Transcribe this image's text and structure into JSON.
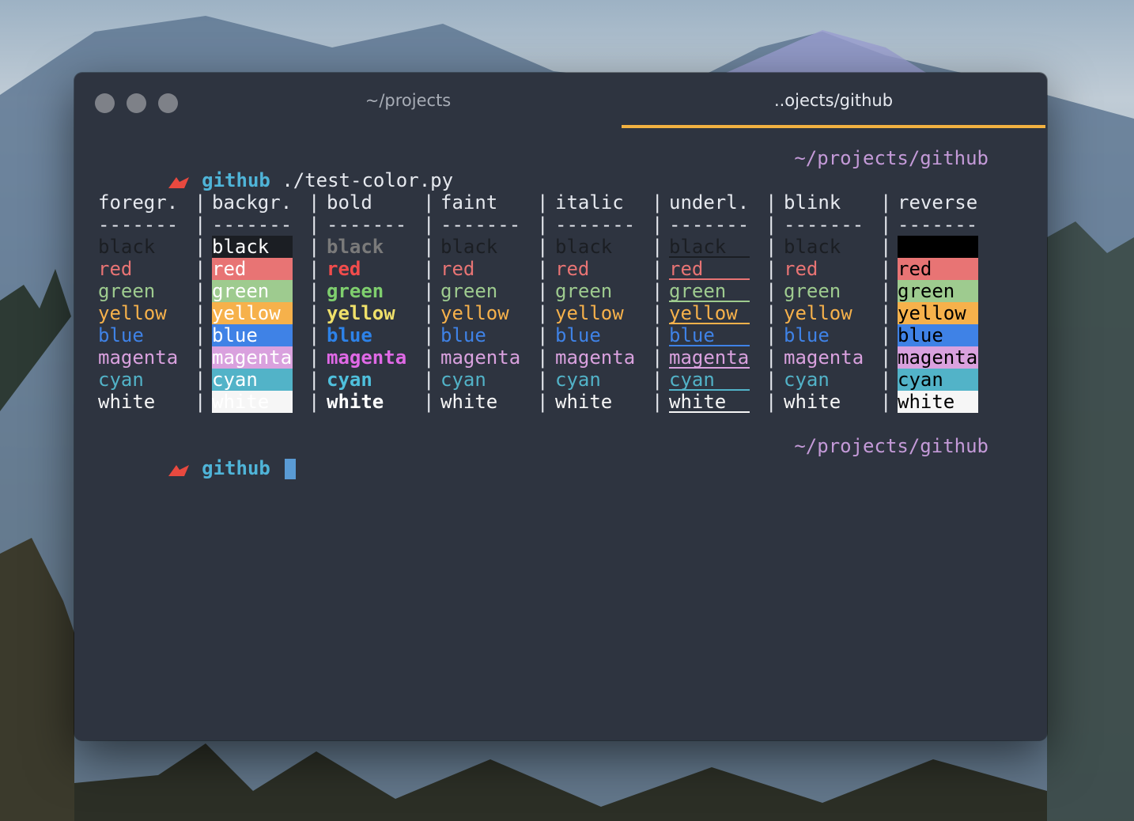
{
  "window": {
    "tabs": [
      {
        "label": "~/projects",
        "active": false
      },
      {
        "label": "..ojects/github",
        "active": true
      }
    ],
    "accent_color": "#f2b141"
  },
  "prompt1": {
    "dir": "github",
    "command": "./test-color.py",
    "path": "~/projects/github"
  },
  "prompt2": {
    "dir": "github",
    "path": "~/projects/github"
  },
  "table": {
    "headers": [
      "foregr.",
      "backgr.",
      "bold",
      "faint",
      "italic",
      "underl.",
      "blink",
      "reverse"
    ],
    "dashes": "-------",
    "separator": "|",
    "colors": [
      "black",
      "red",
      "green",
      "yellow",
      "blue",
      "magenta",
      "cyan",
      "white"
    ]
  },
  "palette": {
    "black": "#1b1e23",
    "red": "#e87474",
    "green": "#9ecb8f",
    "yellow": "#f6b14b",
    "blue": "#3f82e6",
    "magenta": "#d9a1de",
    "cyan": "#52b3c8",
    "white": "#f6f6f6"
  },
  "bold_palette": {
    "black": "#7a7a7a",
    "red": "#f24c4c",
    "green": "#7fcf6e",
    "yellow": "#efe06a",
    "blue": "#2d82e8",
    "magenta": "#e069e6",
    "cyan": "#4fc0dd",
    "white": "#ffffff"
  }
}
